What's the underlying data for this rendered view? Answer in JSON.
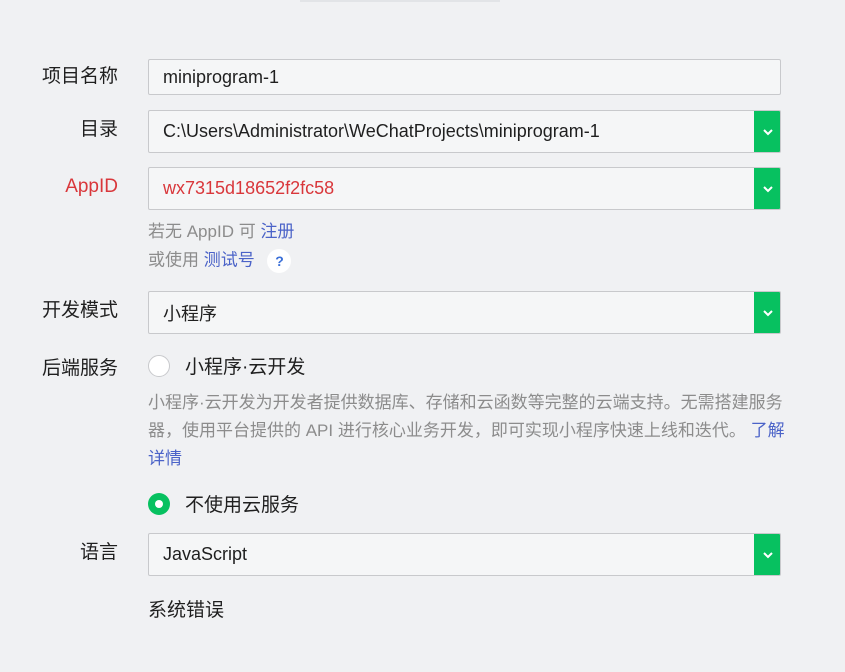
{
  "form": {
    "project_name": {
      "label": "项目名称",
      "value": "miniprogram-1"
    },
    "directory": {
      "label": "目录",
      "value": "C:\\Users\\Administrator\\WeChatProjects\\miniprogram-1"
    },
    "appid": {
      "label": "AppID",
      "value": "wx7315d18652f2fc58",
      "hint_prefix": "若无 AppID 可",
      "register_link": "注册",
      "hint2_prefix": "或使用",
      "test_link": "测试号",
      "help_icon": "?"
    },
    "dev_mode": {
      "label": "开发模式",
      "value": "小程序"
    },
    "backend": {
      "label": "后端服务",
      "option_cloud": "小程序·云开发",
      "cloud_desc": "小程序·云开发为开发者提供数据库、存储和云函数等完整的云端支持。无需搭建服务器，使用平台提供的 API 进行核心业务开发，即可实现小程序快速上线和迭代。",
      "learn_more": "了解详情",
      "option_none": "不使用云服务",
      "selected": "option_none"
    },
    "language": {
      "label": "语言",
      "value": "JavaScript"
    },
    "status_text": "系统错误"
  },
  "colors": {
    "accent": "#07c160",
    "error": "#d9373b",
    "link": "#4b63c8",
    "hint": "#8c8c8c"
  },
  "icons": {
    "select_arrow": "chevron-down-icon",
    "help": "question-icon"
  }
}
